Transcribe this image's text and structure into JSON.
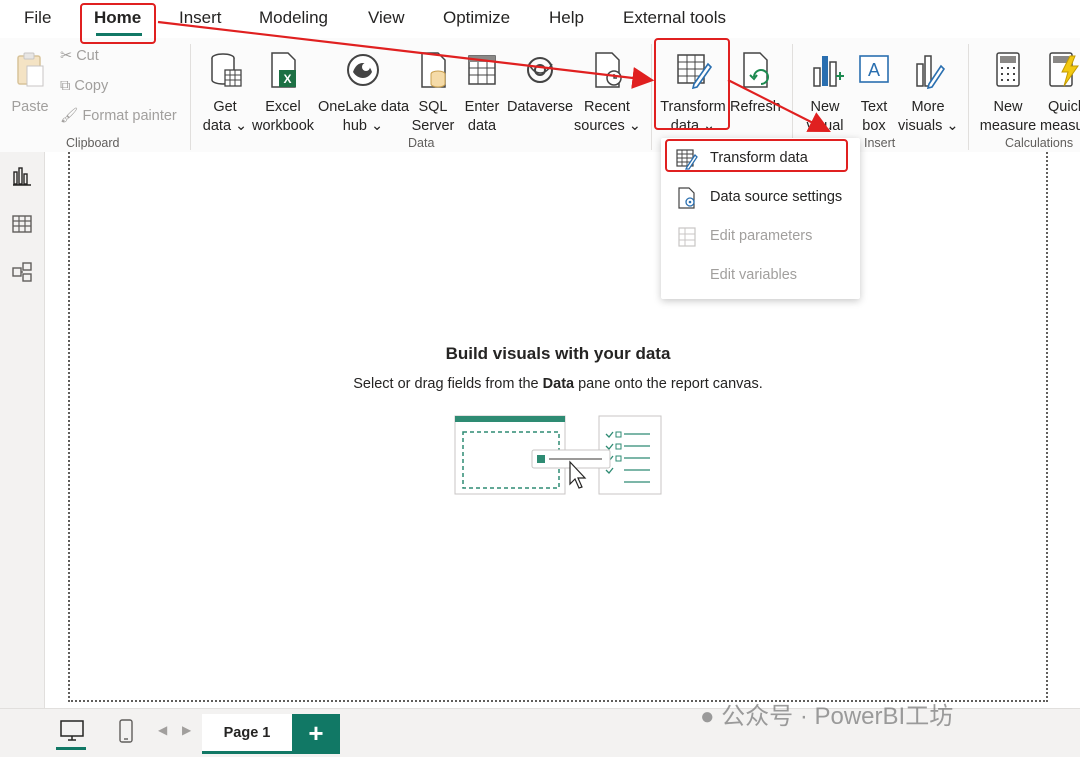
{
  "menu": {
    "file": "File",
    "home": "Home",
    "insert": "Insert",
    "modeling": "Modeling",
    "view": "View",
    "optimize": "Optimize",
    "help": "Help",
    "external_tools": "External tools"
  },
  "ribbon": {
    "clipboard": {
      "paste": "Paste",
      "cut": "Cut",
      "copy": "Copy",
      "format_painter": "Format painter",
      "group_label": "Clipboard"
    },
    "data": {
      "get_data": [
        "Get",
        "data"
      ],
      "excel_workbook": [
        "Excel",
        "workbook"
      ],
      "onelake_hub": [
        "OneLake data",
        "hub"
      ],
      "sql_server": [
        "SQL",
        "Server"
      ],
      "enter_data": [
        "Enter",
        "data"
      ],
      "dataverse": "Dataverse",
      "recent_sources": [
        "Recent",
        "sources"
      ],
      "group_label": "Data"
    },
    "queries": {
      "transform_data": [
        "Transform",
        "data"
      ],
      "refresh": "Refresh"
    },
    "insert": {
      "new_visual": [
        "New",
        "visual"
      ],
      "text_box": [
        "Text",
        "box"
      ],
      "more_visuals": [
        "More",
        "visuals"
      ],
      "group_label": "Insert"
    },
    "calculations": {
      "new_measure": [
        "New",
        "measure"
      ],
      "quick_measure": [
        "Quick",
        "measure"
      ],
      "group_label": "Calculations"
    }
  },
  "dropdown": {
    "items": [
      {
        "label": "Transform data",
        "enabled": true
      },
      {
        "label": "Data source settings",
        "enabled": true
      },
      {
        "label": "Edit parameters",
        "enabled": false
      },
      {
        "label": "Edit variables",
        "enabled": false
      }
    ]
  },
  "canvas": {
    "title": "Build visuals with your data",
    "subtitle_before": "Select or drag fields from the ",
    "subtitle_bold": "Data",
    "subtitle_after": " pane onto the report canvas."
  },
  "pages": {
    "tabs": [
      "Page 1"
    ],
    "add_label": "+"
  },
  "watermark": "公众号 · PowerBI工坊",
  "colors": {
    "accent": "#117865",
    "highlight": "#e02020",
    "disabled_text": "#a19f9d"
  }
}
